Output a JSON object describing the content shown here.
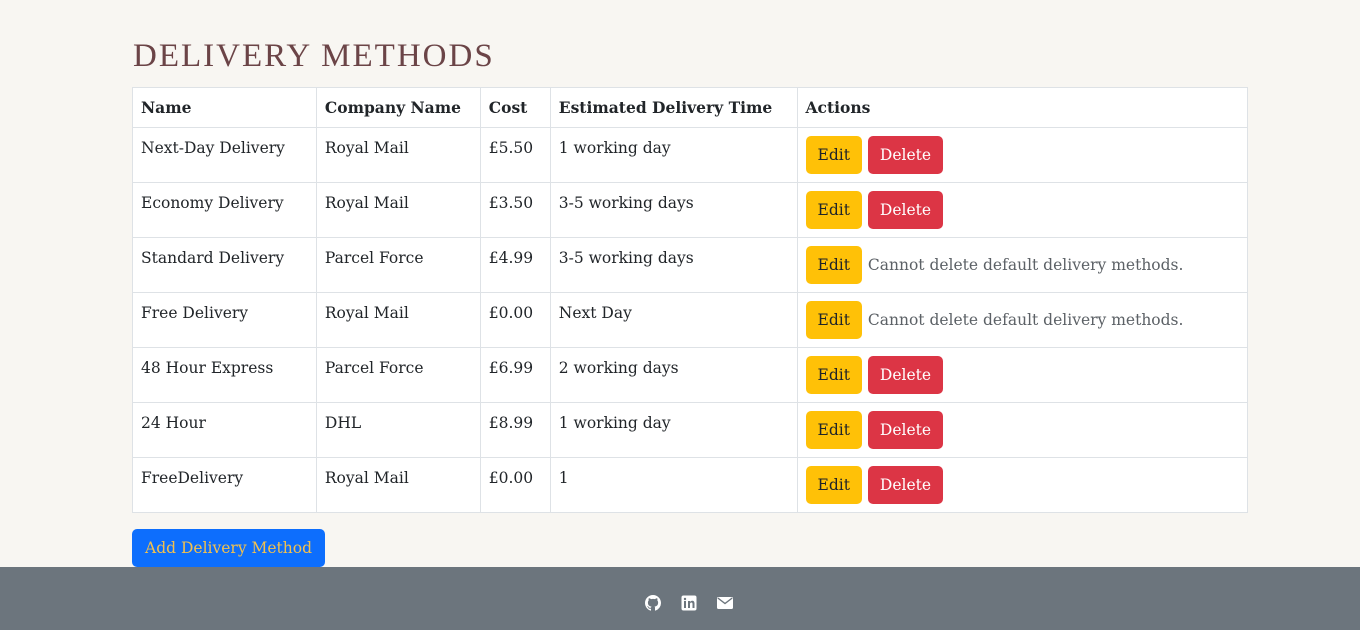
{
  "page": {
    "title": "DELIVERY METHODS"
  },
  "table": {
    "headers": [
      "Name",
      "Company Name",
      "Cost",
      "Estimated Delivery Time",
      "Actions"
    ],
    "rows": [
      {
        "name": "Next-Day Delivery",
        "company": "Royal Mail",
        "cost": "£5.50",
        "time": "1 working day",
        "deletable": true
      },
      {
        "name": "Economy Delivery",
        "company": "Royal Mail",
        "cost": "£3.50",
        "time": "3-5 working days",
        "deletable": true
      },
      {
        "name": "Standard Delivery",
        "company": "Parcel Force",
        "cost": "£4.99",
        "time": "3-5 working days",
        "deletable": false
      },
      {
        "name": "Free Delivery",
        "company": "Royal Mail",
        "cost": "£0.00",
        "time": "Next Day",
        "deletable": false
      },
      {
        "name": "48 Hour Express",
        "company": "Parcel Force",
        "cost": "£6.99",
        "time": "2 working days",
        "deletable": true
      },
      {
        "name": "24 Hour",
        "company": "DHL",
        "cost": "£8.99",
        "time": "1 working day",
        "deletable": true
      },
      {
        "name": "FreeDelivery",
        "company": "Royal Mail",
        "cost": "£0.00",
        "time": "1",
        "deletable": true
      }
    ],
    "edit_label": "Edit",
    "delete_label": "Delete",
    "cannot_delete_note": "Cannot delete default delivery methods."
  },
  "add_button_label": "Add Delivery Method",
  "footer": {
    "icons": [
      "github-icon",
      "linkedin-icon",
      "email-icon"
    ]
  },
  "colors": {
    "background": "#f8f6f2",
    "title": "#6b4447",
    "edit": "#ffc107",
    "delete": "#dc3545",
    "primary": "#0d6efd",
    "footer": "#6c757d"
  }
}
